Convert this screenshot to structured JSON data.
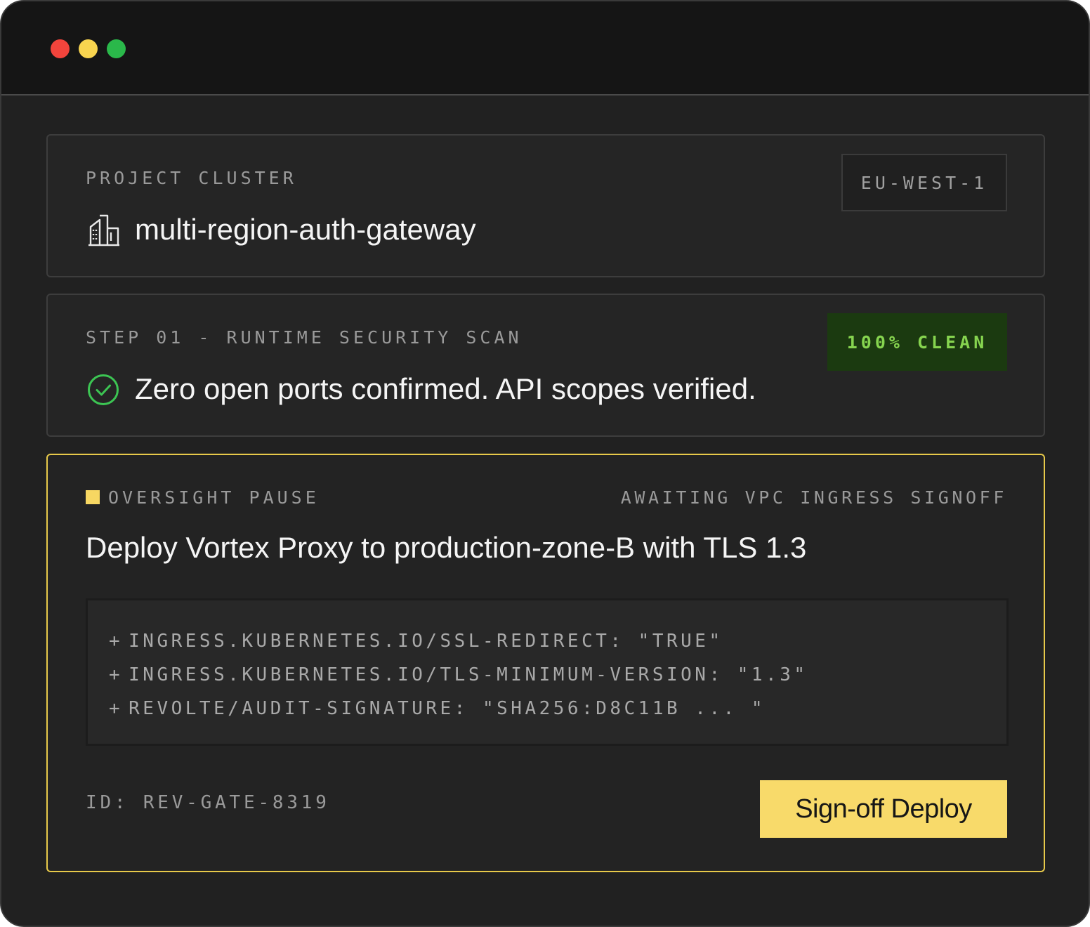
{
  "window": {
    "controls": [
      "close",
      "minimize",
      "maximize"
    ]
  },
  "project": {
    "label": "PROJECT CLUSTER",
    "name": "multi-region-auth-gateway",
    "icon": "building-icon",
    "region": "EU-WEST-1"
  },
  "scan": {
    "label": "STEP 01 - RUNTIME SECURITY SCAN",
    "message": "Zero open ports confirmed. API scopes verified.",
    "icon": "check-circle-icon",
    "badge": "100% CLEAN"
  },
  "oversight": {
    "label": "OVERSIGHT PAUSE",
    "status": "AWAITING VPC INGRESS SIGNOFF",
    "title": "Deploy Vortex Proxy to production-zone-B with TLS 1.3",
    "code_lines": [
      "INGRESS.KUBERNETES.IO/SSL-REDIRECT: \"TRUE\"",
      "INGRESS.KUBERNETES.IO/TLS-MINIMUM-VERSION: \"1.3\"",
      "REVOLTE/AUDIT-SIGNATURE: \"SHA256:D8C11B ... \""
    ],
    "gate_id": "ID: REV-GATE-8319",
    "action_label": "Sign-off Deploy"
  },
  "colors": {
    "accent": "#f8da6a",
    "success": "#86d44f",
    "success_bg": "#1b3a10",
    "close": "#f2443c",
    "minimize": "#f8d44f",
    "maximize": "#2ab84a"
  }
}
